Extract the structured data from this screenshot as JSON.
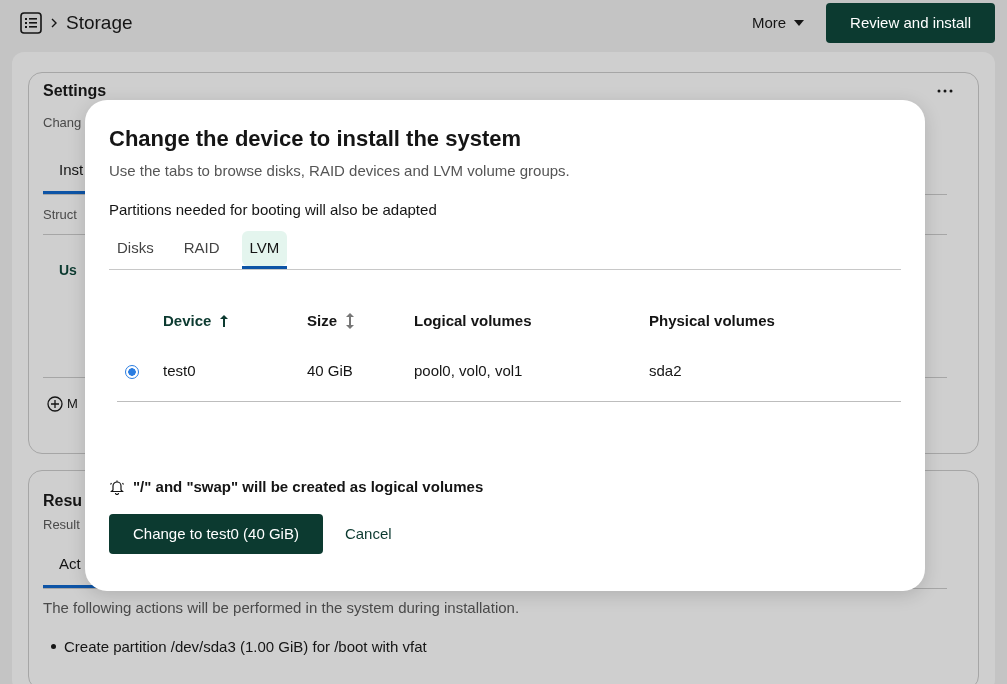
{
  "header": {
    "title": "Storage",
    "more": "More",
    "primary": "Review and install"
  },
  "settings_card": {
    "title": "Settings",
    "subtitle": "Chang",
    "tab": "Inst",
    "text": "Struct",
    "heading": "Us",
    "action": "M"
  },
  "result_card": {
    "title": "Resu",
    "subtitle": "Result",
    "tab": "Act",
    "text": "The following actions will be performed in the system during installation.",
    "items": [
      "Create partition /dev/sda3 (1.00 GiB) for /boot with vfat"
    ]
  },
  "dialog": {
    "title": "Change the device to install the system",
    "description": "Use the tabs to browse disks, RAID devices and LVM volume groups.",
    "notice": "Partitions needed for booting will also be adapted",
    "tabs": [
      {
        "label": "Disks",
        "selected": false
      },
      {
        "label": "RAID",
        "selected": false
      },
      {
        "label": "LVM",
        "selected": true
      }
    ],
    "table": {
      "columns": [
        {
          "label": "Device",
          "sortable": true,
          "sorted": true
        },
        {
          "label": "Size",
          "sortable": true,
          "sorted": false
        },
        {
          "label": "Logical volumes",
          "sortable": false,
          "sorted": false
        },
        {
          "label": "Physical volumes",
          "sortable": false,
          "sorted": false
        }
      ],
      "rows": [
        {
          "selected": true,
          "cells": [
            "test0",
            "40 GiB",
            "pool0, vol0, vol1",
            "sda2"
          ]
        }
      ]
    },
    "info": "\"/\" and \"swap\" will be created as logical volumes",
    "primary": "Change to test0 (40 GiB)",
    "cancel": "Cancel"
  }
}
